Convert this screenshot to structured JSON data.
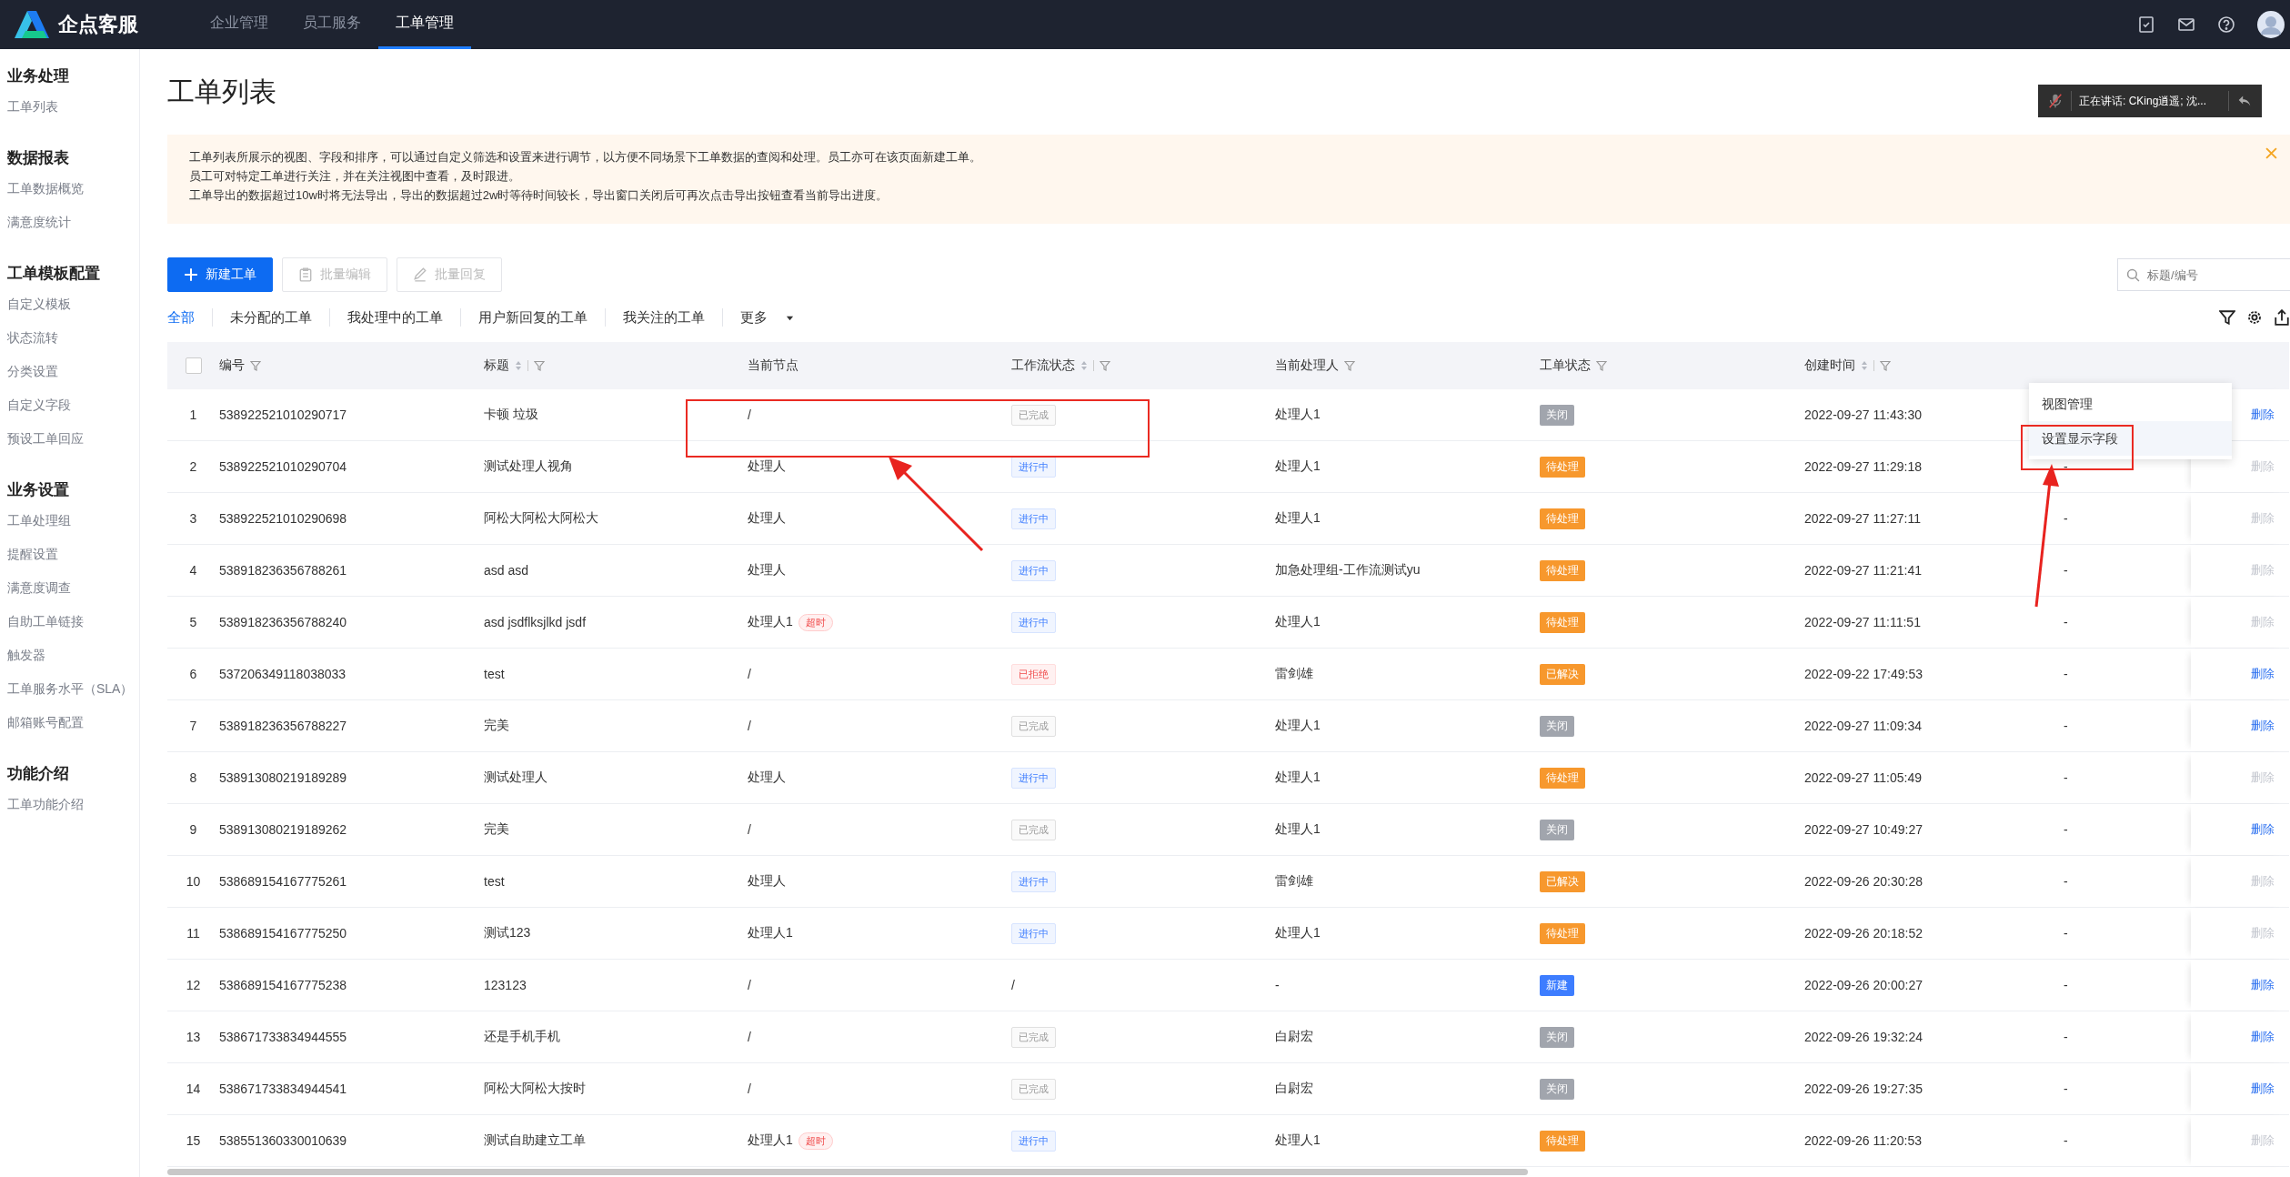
{
  "header": {
    "logo": "企点客服",
    "nav": [
      {
        "label": "企业管理",
        "selected": false
      },
      {
        "label": "员工服务",
        "selected": false
      },
      {
        "label": "工单管理",
        "selected": true
      }
    ]
  },
  "sidebar": [
    {
      "title": "业务处理",
      "items": [
        "工单列表"
      ]
    },
    {
      "title": "数据报表",
      "items": [
        "工单数据概览",
        "满意度统计"
      ]
    },
    {
      "title": "工单模板配置",
      "items": [
        "自定义模板",
        "状态流转",
        "分类设置",
        "自定义字段",
        "预设工单回应"
      ]
    },
    {
      "title": "业务设置",
      "items": [
        "工单处理组",
        "提醒设置",
        "满意度调查",
        "自助工单链接",
        "触发器",
        "工单服务水平（SLA）",
        "邮箱账号配置"
      ]
    },
    {
      "title": "功能介绍",
      "items": [
        "工单功能介绍"
      ]
    }
  ],
  "page_title": "工单列表",
  "voice_bar": {
    "text": "正在讲话: CKing逍遥; 沈..."
  },
  "notice": [
    "工单列表所展示的视图、字段和排序，可以通过自定义筛选和设置来进行调节，以方便不同场景下工单数据的查阅和处理。员工亦可在该页面新建工单。",
    "员工可对特定工单进行关注，并在关注视图中查看，及时跟进。",
    "工单导出的数据超过10w时将无法导出，导出的数据超过2w时等待时间较长，导出窗口关闭后可再次点击导出按钮查看当前导出进度。"
  ],
  "toolbar": {
    "new_button": "新建工单",
    "batch_edit": "批量编辑",
    "batch_reply": "批量回复",
    "search": {
      "placeholder": "标题/编号"
    }
  },
  "views": [
    {
      "label": "全部",
      "selected": true
    },
    {
      "label": "未分配的工单",
      "selected": false
    },
    {
      "label": "我处理中的工单",
      "selected": false
    },
    {
      "label": "用户新回复的工单",
      "selected": false
    },
    {
      "label": "我关注的工单",
      "selected": false
    },
    {
      "label": "更多",
      "selected": false
    }
  ],
  "dropdown": [
    "视图管理",
    "设置显示字段"
  ],
  "select_all": {
    "checked": false
  },
  "columns": [
    {
      "label": "编号",
      "sortable": false
    },
    {
      "label": "标题",
      "sortable": true
    },
    {
      "label": "当前节点",
      "sortable": false,
      "filter": false
    },
    {
      "label": "工作流状态",
      "sortable": true
    },
    {
      "label": "当前处理人",
      "sortable": false
    },
    {
      "label": "工单状态",
      "sortable": false
    },
    {
      "label": "创建时间",
      "sortable": true
    }
  ],
  "rows": [
    {
      "index": "1",
      "id": "538922521010290717",
      "title": "卡顿 垃圾",
      "node": "/",
      "wf": {
        "kind": "done",
        "text": "已完成"
      },
      "handler": "处理人1",
      "status": {
        "kind": "closed",
        "text": "关闭"
      },
      "time": "2022-09-27 11:43:30",
      "delete": {
        "text": "删除",
        "disabled": false
      }
    },
    {
      "index": "2",
      "id": "538922521010290704",
      "title": "测试处理人视角",
      "node": "处理人",
      "wf": {
        "kind": "progress",
        "text": "进行中"
      },
      "handler": "处理人1",
      "status": {
        "kind": "pending",
        "text": "待处理"
      },
      "time": "2022-09-27 11:29:18",
      "column_9": "-",
      "delete": {
        "text": "删除",
        "disabled": true
      }
    },
    {
      "index": "3",
      "id": "538922521010290698",
      "title": "阿松大阿松大阿松大",
      "node": "处理人",
      "wf": {
        "kind": "progress",
        "text": "进行中"
      },
      "handler": "处理人1",
      "status": {
        "kind": "pending",
        "text": "待处理"
      },
      "time": "2022-09-27 11:27:11",
      "column_9": "-",
      "delete": {
        "text": "删除",
        "disabled": true
      }
    },
    {
      "index": "4",
      "id": "538918236356788261",
      "title": "asd asd",
      "node": "处理人",
      "wf": {
        "kind": "progress",
        "text": "进行中"
      },
      "handler": "加急处理组-工作流测试yu",
      "status": {
        "kind": "pending",
        "text": "待处理"
      },
      "time": "2022-09-27 11:21:41",
      "column_9": "-",
      "delete": {
        "text": "删除",
        "disabled": true
      }
    },
    {
      "index": "5",
      "id": "538918236356788240",
      "title": "asd jsdflksjlkd jsdf",
      "node": "处理人1",
      "node_badge": "超时",
      "wf": {
        "kind": "progress",
        "text": "进行中"
      },
      "handler": "处理人1",
      "status": {
        "kind": "pending",
        "text": "待处理"
      },
      "time": "2022-09-27 11:11:51",
      "column_9": "-",
      "delete": {
        "text": "删除",
        "disabled": true
      }
    },
    {
      "index": "6",
      "id": "537206349118038033",
      "title": "test",
      "node": "/",
      "wf": {
        "kind": "rejected",
        "text": "已拒绝"
      },
      "handler": "雷剑雄",
      "status": {
        "kind": "resolved",
        "text": "已解决"
      },
      "time": "2022-09-22 17:49:53",
      "column_9": "-",
      "delete": {
        "text": "删除",
        "disabled": false
      }
    },
    {
      "index": "7",
      "id": "538918236356788227",
      "title": "完美",
      "node": "/",
      "wf": {
        "kind": "done",
        "text": "已完成"
      },
      "handler": "处理人1",
      "status": {
        "kind": "closed",
        "text": "关闭"
      },
      "time": "2022-09-27 11:09:34",
      "column_9": "-",
      "delete": {
        "text": "删除",
        "disabled": false
      }
    },
    {
      "index": "8",
      "id": "538913080219189289",
      "title": "测试处理人",
      "node": "处理人",
      "wf": {
        "kind": "progress",
        "text": "进行中"
      },
      "handler": "处理人1",
      "status": {
        "kind": "pending",
        "text": "待处理"
      },
      "time": "2022-09-27 11:05:49",
      "column_9": "-",
      "delete": {
        "text": "删除",
        "disabled": true
      }
    },
    {
      "index": "9",
      "id": "538913080219189262",
      "title": "完美",
      "node": "/",
      "wf": {
        "kind": "done",
        "text": "已完成"
      },
      "handler": "处理人1",
      "status": {
        "kind": "closed",
        "text": "关闭"
      },
      "time": "2022-09-27 10:49:27",
      "column_9": "-",
      "delete": {
        "text": "删除",
        "disabled": false
      }
    },
    {
      "index": "10",
      "id": "538689154167775261",
      "title": "test",
      "node": "处理人",
      "wf": {
        "kind": "progress",
        "text": "进行中"
      },
      "handler": "雷剑雄",
      "status": {
        "kind": "resolved",
        "text": "已解决"
      },
      "time": "2022-09-26 20:30:28",
      "column_9": "-",
      "delete": {
        "text": "删除",
        "disabled": true
      }
    },
    {
      "index": "11",
      "id": "538689154167775250",
      "title": "测试123",
      "node": "处理人1",
      "wf": {
        "kind": "progress",
        "text": "进行中"
      },
      "handler": "处理人1",
      "status": {
        "kind": "pending",
        "text": "待处理"
      },
      "time": "2022-09-26 20:18:52",
      "column_9": "-",
      "delete": {
        "text": "删除",
        "disabled": true
      }
    },
    {
      "index": "12",
      "id": "538689154167775238",
      "title": "123123",
      "node": "/",
      "wf": {
        "kind": "none",
        "text": "/"
      },
      "handler": "-",
      "status": {
        "kind": "new",
        "text": "新建"
      },
      "time": "2022-09-26 20:00:27",
      "column_9": "-",
      "delete": {
        "text": "删除",
        "disabled": false
      }
    },
    {
      "index": "13",
      "id": "538671733834944555",
      "title": "还是手机手机",
      "node": "/",
      "wf": {
        "kind": "done",
        "text": "已完成"
      },
      "handler": "白尉宏",
      "status": {
        "kind": "closed",
        "text": "关闭"
      },
      "time": "2022-09-26 19:32:24",
      "column_9": "-",
      "delete": {
        "text": "删除",
        "disabled": false
      }
    },
    {
      "index": "14",
      "id": "538671733834944541",
      "title": "阿松大阿松大按时",
      "node": "/",
      "wf": {
        "kind": "done",
        "text": "已完成"
      },
      "handler": "白尉宏",
      "status": {
        "kind": "closed",
        "text": "关闭"
      },
      "time": "2022-09-26 19:27:35",
      "column_9": "-",
      "delete": {
        "text": "删除",
        "disabled": false
      }
    },
    {
      "index": "15",
      "id": "538551360330010639",
      "title": "测试自助建立工单",
      "node": "处理人1",
      "node_badge": "超时",
      "wf": {
        "kind": "progress",
        "text": "进行中"
      },
      "handler": "处理人1",
      "status": {
        "kind": "pending",
        "text": "待处理"
      },
      "time": "2022-09-26 11:20:53",
      "column_9": "-",
      "delete": {
        "text": "删除",
        "disabled": true
      }
    }
  ]
}
